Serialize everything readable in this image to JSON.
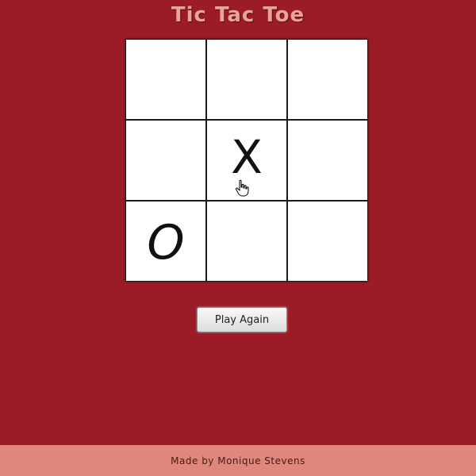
{
  "title": "Tic Tac Toe",
  "board": {
    "cells": [
      {
        "mark": ""
      },
      {
        "mark": ""
      },
      {
        "mark": ""
      },
      {
        "mark": ""
      },
      {
        "mark": "X"
      },
      {
        "mark": ""
      },
      {
        "mark": "O"
      },
      {
        "mark": ""
      },
      {
        "mark": ""
      }
    ]
  },
  "play_again_label": "Play Again",
  "footer_text": "Made by Monique Stevens",
  "colors": {
    "background": "#9b1c26",
    "title": "#e8a39a",
    "footer_bg": "#e0877c"
  }
}
